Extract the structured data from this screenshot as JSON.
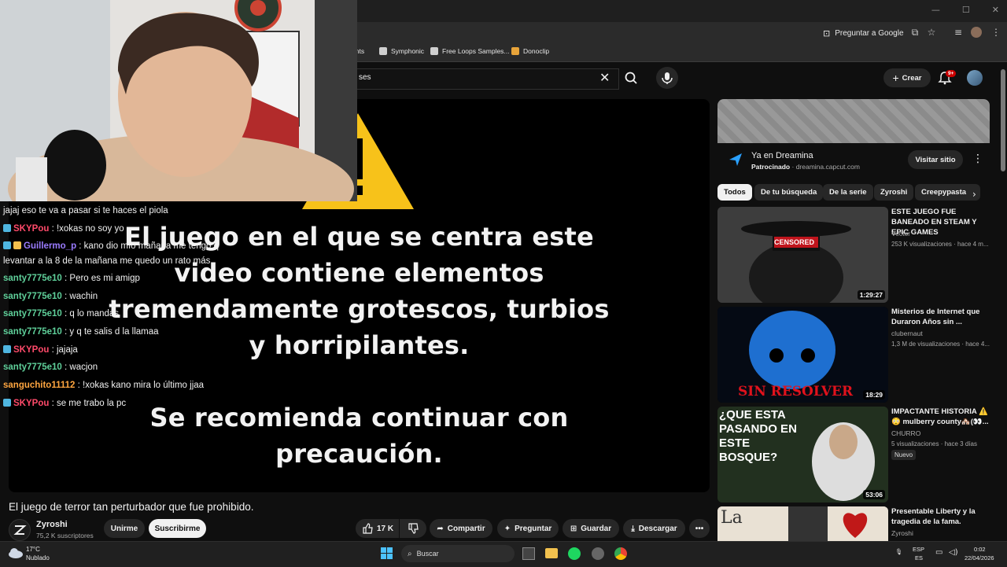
{
  "browser": {
    "ask_google": "Preguntar a Google",
    "bookmarks": [
      {
        "label": "ments",
        "color": "#5b8def"
      },
      {
        "label": "Symphonic",
        "color": "#cfcfcf"
      },
      {
        "label": "Free Loops Samples...",
        "color": "#cfcfcf"
      },
      {
        "label": "Donoclip",
        "color": "#e8a43a"
      }
    ]
  },
  "header": {
    "search_value": "ses",
    "create_label": "Crear",
    "notifications_badge": "9+"
  },
  "player": {
    "warning_lines": [
      "El juego en el que se centra este",
      "video contiene elementos",
      "tremendamente grotescos, turbios",
      "y horripilantes.",
      "Se recomienda continuar con",
      "precaución."
    ]
  },
  "chat": [
    {
      "nick": "",
      "text": "jajaj eso te va a pasar si te haces el piola",
      "color": "#ffffff",
      "badges": 0
    },
    {
      "nick": "SKYPou",
      "text": ": !xokas no soy yo",
      "color": "#ff4a6a",
      "badges": 1
    },
    {
      "nick": "Guillermo_p",
      "text": ": kano dio mío mañana me tengo q",
      "color": "#9a7bff",
      "badges": 2
    },
    {
      "nick": "",
      "text": "levantar a la 8 de la mañana me quedo un rato más",
      "color": "#ffffff",
      "badges": 0
    },
    {
      "nick": "santy7775e10",
      "text": ": Pero es mi amigp",
      "color": "#5fd09a",
      "badges": 0
    },
    {
      "nick": "santy7775e10",
      "text": ": wachin",
      "color": "#5fd09a",
      "badges": 0
    },
    {
      "nick": "santy7775e10",
      "text": ": q lo mandas",
      "color": "#5fd09a",
      "badges": 0
    },
    {
      "nick": "santy7775e10",
      "text": ": y q te salis d la llamaa",
      "color": "#5fd09a",
      "badges": 0
    },
    {
      "nick": "SKYPou",
      "text": ": jajaja",
      "color": "#ff4a6a",
      "badges": 1
    },
    {
      "nick": "santy7775e10",
      "text": ": wacjon",
      "color": "#5fd09a",
      "badges": 0
    },
    {
      "nick": "sanguchito11112",
      "text": ": !xokas kano mira lo último jjaa",
      "color": "#ffa640",
      "badges": 0
    },
    {
      "nick": "SKYPou",
      "text": ": se me trabo la pc",
      "color": "#ff4a6a",
      "badges": 1
    }
  ],
  "ad": {
    "title": "Ya en Dreamina",
    "sponsored": "Patrocinado",
    "domain": "· dreamina.capcut.com",
    "visit_label": "Visitar sitio"
  },
  "chips": [
    "Todos",
    "De tu búsqueda",
    "De la serie",
    "Zyroshi",
    "Creepypasta"
  ],
  "related": [
    {
      "title": "ESTE JUEGO FUE BANEADO EN STEAM Y EPIC GAMES",
      "channel": "Vector",
      "meta": "253 K visualizaciones · hace 4 m...",
      "duration": "1:29:27",
      "thumb_label": "CENSORED",
      "new": ""
    },
    {
      "title": "Misterios de Internet que Duraron Años sin ...",
      "channel": "clubernaut",
      "meta": "1,3 M de visualizaciones · hace 4...",
      "duration": "18:29",
      "thumb_label": "SIN RESOLVER",
      "new": ""
    },
    {
      "title": "IMPACTANTE HISTORIA ⚠️ 😳 mulberry county🏘️(👀...",
      "channel": "CHURRO",
      "meta": "5 visualizaciones · hace 3 días",
      "duration": "53:06",
      "thumb_label": "¿QUE ESTA PASANDO EN ESTE BOSQUE?",
      "new": "Nuevo"
    },
    {
      "title": "Presentable Liberty y la tragedia de la fama.",
      "channel": "Zyroshi",
      "meta": "",
      "duration": "",
      "thumb_label": "La",
      "new": ""
    }
  ],
  "video": {
    "title": "El juego de terror tan perturbador que fue prohibido.",
    "channel": "Zyroshi",
    "subscribers": "75,2 K suscriptores",
    "unsubscribe_label": "Unirme",
    "subscribe_label": "Suscribirme",
    "likes": "17 K",
    "share_label": "Compartir",
    "ask_label": "Preguntar",
    "save_label": "Guardar",
    "download_label": "Descargar"
  },
  "taskbar": {
    "temp": "17°C",
    "weather": "Nublado",
    "search_label": "Buscar",
    "lang_top": "ESP",
    "lang_bottom": "ES",
    "time": "0:02",
    "date": "22/04/2026"
  }
}
